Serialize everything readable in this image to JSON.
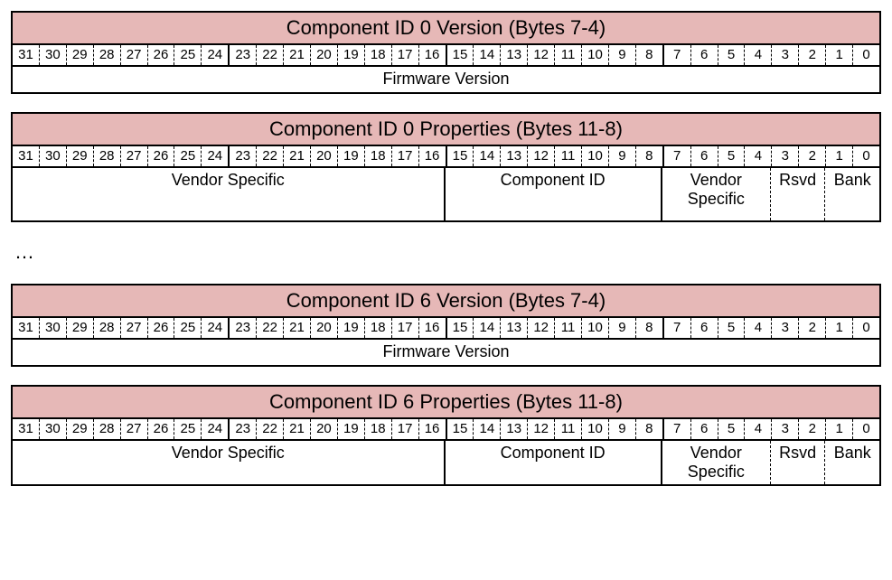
{
  "bits": [
    "31",
    "30",
    "29",
    "28",
    "27",
    "26",
    "25",
    "24",
    "23",
    "22",
    "21",
    "20",
    "19",
    "18",
    "17",
    "16",
    "15",
    "14",
    "13",
    "12",
    "11",
    "10",
    "9",
    "8",
    "7",
    "6",
    "5",
    "4",
    "3",
    "2",
    "1",
    "0"
  ],
  "ellipsis": "…",
  "regs": [
    {
      "title": "Component ID 0 Version (Bytes 7-4)",
      "tall": false,
      "fields": [
        {
          "label": "Firmware Version",
          "span": 32,
          "sep": ""
        }
      ]
    },
    {
      "title": "Component ID 0 Properties (Bytes 11-8)",
      "tall": true,
      "fields": [
        {
          "label": "Vendor Specific",
          "span": 16,
          "sep": "solid"
        },
        {
          "label": "Component ID",
          "span": 8,
          "sep": "solid"
        },
        {
          "label": "Vendor Specific",
          "span": 4,
          "sep": "dash"
        },
        {
          "label": "Rsvd",
          "span": 2,
          "sep": "dash"
        },
        {
          "label": "Bank",
          "span": 2,
          "sep": ""
        }
      ]
    },
    {
      "title": "Component ID 6 Version (Bytes 7-4)",
      "tall": false,
      "fields": [
        {
          "label": "Firmware Version",
          "span": 32,
          "sep": ""
        }
      ]
    },
    {
      "title": "Component ID 6 Properties (Bytes 11-8)",
      "tall": false,
      "fields": [
        {
          "label": "Vendor Specific",
          "span": 16,
          "sep": "solid"
        },
        {
          "label": "Component ID",
          "span": 8,
          "sep": "solid"
        },
        {
          "label": "Vendor Specific",
          "span": 4,
          "sep": "dash"
        },
        {
          "label": "Rsvd",
          "span": 2,
          "sep": "dash"
        },
        {
          "label": "Bank",
          "span": 2,
          "sep": ""
        }
      ]
    }
  ]
}
